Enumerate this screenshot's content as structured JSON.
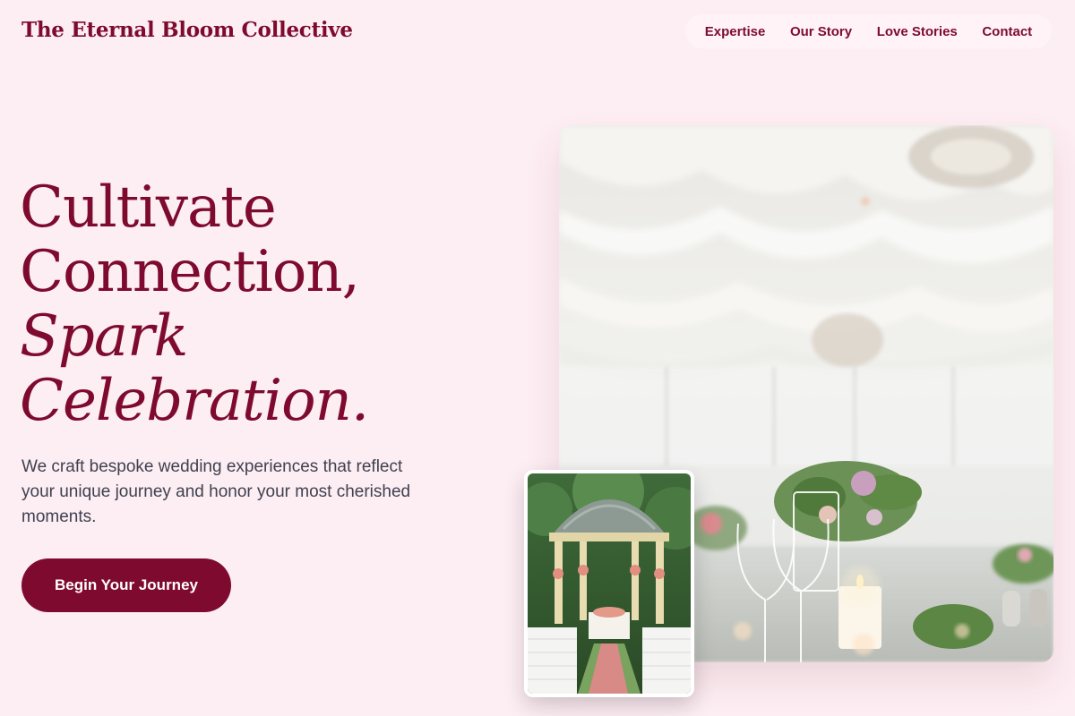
{
  "brand": {
    "name": "The Eternal Bloom Collective"
  },
  "nav": {
    "items": [
      {
        "label": "Expertise"
      },
      {
        "label": "Our Story"
      },
      {
        "label": "Love Stories"
      },
      {
        "label": "Contact"
      }
    ]
  },
  "hero": {
    "headline": {
      "line1": "Cultivate",
      "line2": "Connection,",
      "line3": "Spark",
      "line4": "Celebration."
    },
    "lead": "We craft bespoke wedding experiences that reflect your unique journey and honor your most cherished moments.",
    "cta_label": "Begin Your Journey"
  },
  "images": {
    "main": {
      "subject": "wedding tent interior with glassware and flowers"
    },
    "secondary": {
      "subject": "garden gazebo ceremony aisle"
    }
  },
  "colors": {
    "background": "#fdeef3",
    "accent": "#7e0b2f",
    "body_text": "#3f4150"
  }
}
